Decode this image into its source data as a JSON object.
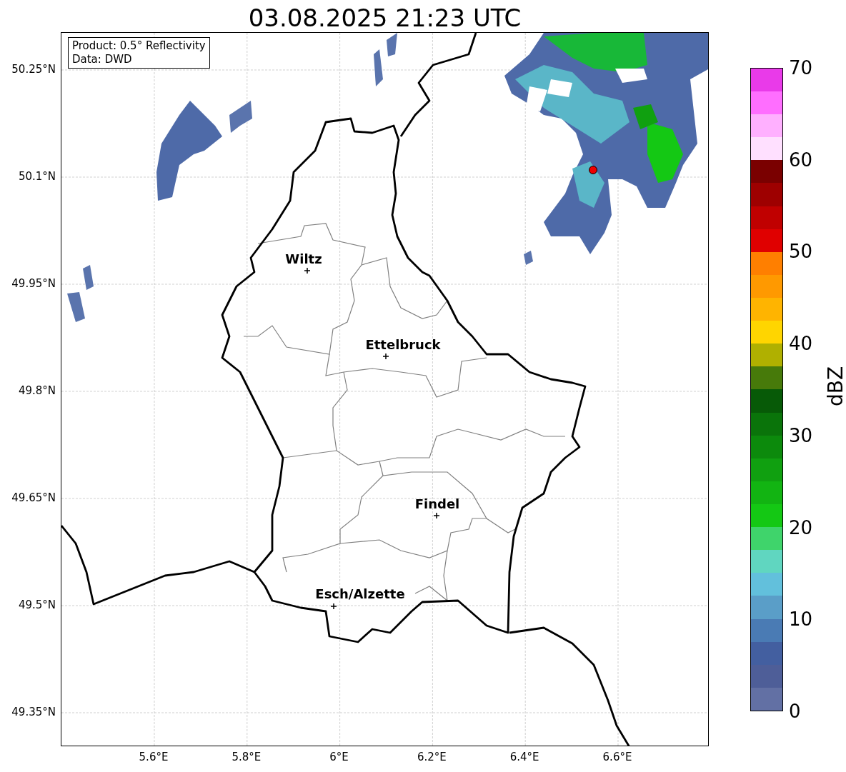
{
  "title": "03.08.2025 21:23 UTC",
  "info_box": [
    "Product: 0.5° Reflectivity",
    "Data: DWD"
  ],
  "lat_ticks": [
    "50.25°N",
    "50.1°N",
    "49.95°N",
    "49.8°N",
    "49.65°N",
    "49.5°N",
    "49.35°N"
  ],
  "lon_ticks": [
    "5.6°E",
    "5.8°E",
    "6°E",
    "6.2°E",
    "6.4°E",
    "6.6°E"
  ],
  "cities": [
    {
      "name": "Wiltz"
    },
    {
      "name": "Ettelbruck"
    },
    {
      "name": "Findel"
    },
    {
      "name": "Esch/Alzette"
    }
  ],
  "colorbar": {
    "label": "dBZ",
    "ticks": [
      "70",
      "60",
      "50",
      "40",
      "30",
      "20",
      "10",
      "0"
    ],
    "bands": [
      {
        "color": "#6270a4"
      },
      {
        "color": "#4e5e98"
      },
      {
        "color": "#435fa0"
      },
      {
        "color": "#4a7bb4"
      },
      {
        "color": "#5a9ec8"
      },
      {
        "color": "#62c0dc"
      },
      {
        "color": "#60d6c0"
      },
      {
        "color": "#3fd46b"
      },
      {
        "color": "#14c814"
      },
      {
        "color": "#12b412"
      },
      {
        "color": "#10a010"
      },
      {
        "color": "#0c8a0c"
      },
      {
        "color": "#0a740a"
      },
      {
        "color": "#075a07"
      },
      {
        "color": "#477a0a"
      },
      {
        "color": "#b0b000"
      },
      {
        "color": "#ffd500"
      },
      {
        "color": "#ffb400"
      },
      {
        "color": "#ff9900"
      },
      {
        "color": "#ff7f00"
      },
      {
        "color": "#e00000"
      },
      {
        "color": "#c00000"
      },
      {
        "color": "#9e0000"
      },
      {
        "color": "#7a0000"
      },
      {
        "color": "#ffe0ff"
      },
      {
        "color": "#ffb0ff"
      },
      {
        "color": "#ff6eff"
      },
      {
        "color": "#e93ae9"
      }
    ]
  }
}
